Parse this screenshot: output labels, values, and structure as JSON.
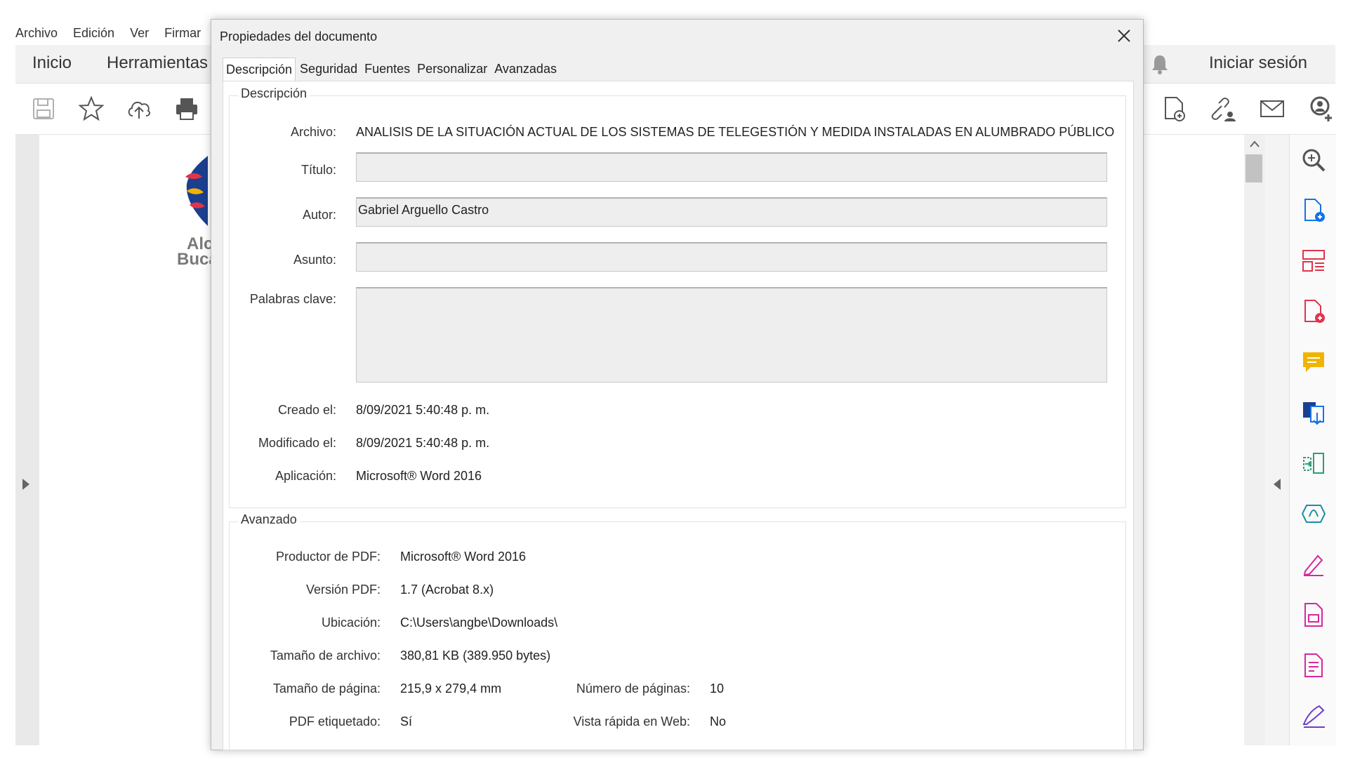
{
  "menubar": [
    "Archivo",
    "Edición",
    "Ver",
    "Firmar"
  ],
  "topbar": {
    "home": "Inicio",
    "tools": "Herramientas",
    "signin": "Iniciar sesión"
  },
  "logo": {
    "line1": "Alc",
    "line2": "Buca"
  },
  "dialog": {
    "title": "Propiedades del documento",
    "tabs": [
      "Descripción",
      "Seguridad",
      "Fuentes",
      "Personalizar",
      "Avanzadas"
    ],
    "description": {
      "group_title": "Descripción",
      "file_label": "Archivo:",
      "file_value": "ANALISIS DE LA SITUACIÓN ACTUAL DE LOS SISTEMAS DE TELEGESTIÓN Y MEDIDA INSTALADAS EN ALUMBRADO PÚBLICO",
      "title_label": "Título:",
      "title_value": "",
      "author_label": "Autor:",
      "author_value": "Gabriel Arguello Castro",
      "subject_label": "Asunto:",
      "subject_value": "",
      "keywords_label": "Palabras clave:",
      "keywords_value": "",
      "created_label": "Creado el:",
      "created_value": "8/09/2021 5:40:48 p. m.",
      "modified_label": "Modificado el:",
      "modified_value": "8/09/2021 5:40:48 p. m.",
      "app_label": "Aplicación:",
      "app_value": "Microsoft® Word 2016"
    },
    "advanced": {
      "group_title": "Avanzado",
      "producer_label": "Productor de PDF:",
      "producer_value": "Microsoft® Word 2016",
      "version_label": "Versión PDF:",
      "version_value": "1.7 (Acrobat 8.x)",
      "location_label": "Ubicación:",
      "location_value": "C:\\Users\\angbe\\Downloads\\",
      "filesize_label": "Tamaño de archivo:",
      "filesize_value": "380,81 KB (389.950 bytes)",
      "pagesize_label": "Tamaño de página:",
      "pagesize_value": "215,9 x 279,4 mm",
      "pages_label": "Número de páginas:",
      "pages_value": "10",
      "tagged_label": "PDF etiquetado:",
      "tagged_value": "Sí",
      "fastweb_label": "Vista rápida en Web:",
      "fastweb_value": "No"
    }
  },
  "colors": {
    "accent_blue": "#1473e6",
    "icon_red": "#e0344b",
    "icon_pink": "#d8279b",
    "icon_yellow": "#f0b400",
    "icon_green": "#2d9d78"
  },
  "icons": [
    "save-icon",
    "star-icon",
    "upload-icon",
    "print-icon",
    "bell-icon",
    "export-pdf-icon",
    "share-link-icon",
    "mail-icon",
    "add-user-icon",
    "zoom-icon",
    "create-pdf-icon",
    "organize-icon",
    "edit-pdf-icon",
    "comment-icon",
    "combine-icon",
    "compress-icon",
    "convert-icon",
    "fill-sign-icon",
    "protect-icon",
    "redact-icon",
    "signature-icon"
  ]
}
